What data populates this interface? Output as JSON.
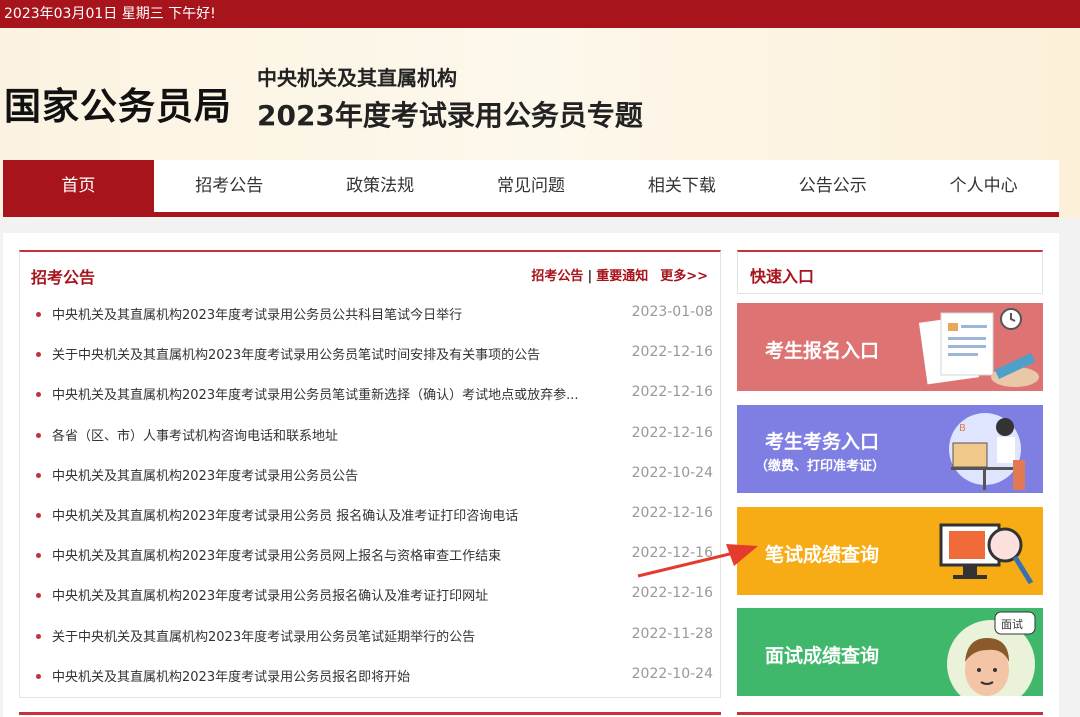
{
  "topbar": {
    "date_text": "2023年03月01日  星期三  下午好!"
  },
  "header": {
    "brand": "国家公务员局",
    "subtitle1": "中央机关及其直属机构",
    "subtitle2": "2023年度考试录用公务员专题"
  },
  "nav": {
    "items": [
      {
        "label": "首页"
      },
      {
        "label": "招考公告"
      },
      {
        "label": "政策法规"
      },
      {
        "label": "常见问题"
      },
      {
        "label": "相关下载"
      },
      {
        "label": "公告公示"
      },
      {
        "label": "个人中心"
      }
    ]
  },
  "panel": {
    "title": "招考公告",
    "link1": "招考公告",
    "separator": "|",
    "link2": "重要通知",
    "more": "更多>>",
    "items": [
      {
        "title": "中央机关及其直属机构2023年度考试录用公务员公共科目笔试今日举行",
        "date": "2023-01-08"
      },
      {
        "title": "关于中央机关及其直属机构2023年度考试录用公务员笔试时间安排及有关事项的公告",
        "date": "2022-12-16"
      },
      {
        "title": "中央机关及其直属机构2023年度考试录用公务员笔试重新选择（确认）考试地点或放弃参...",
        "date": "2022-12-16"
      },
      {
        "title": "各省（区、市）人事考试机构咨询电话和联系地址",
        "date": "2022-12-16"
      },
      {
        "title": "中央机关及其直属机构2023年度考试录用公务员公告",
        "date": "2022-10-24"
      },
      {
        "title": "中央机关及其直属机构2023年度考试录用公务员 报名确认及准考证打印咨询电话",
        "date": "2022-12-16"
      },
      {
        "title": "中央机关及其直属机构2023年度考试录用公务员网上报名与资格审查工作结束",
        "date": "2022-12-16"
      },
      {
        "title": "中央机关及其直属机构2023年度考试录用公务员报名确认及准考证打印网址",
        "date": "2022-12-16"
      },
      {
        "title": "关于中央机关及其直属机构2023年度考试录用公务员笔试延期举行的公告",
        "date": "2022-11-28"
      },
      {
        "title": "中央机关及其直属机构2023年度考试录用公务员报名即将开始",
        "date": "2022-10-24"
      }
    ]
  },
  "quick": {
    "title": "快速入口",
    "cards": [
      {
        "label": "考生报名入口",
        "color": "#de7373"
      },
      {
        "label": "考生考务入口",
        "sublabel": "（缴费、打印准考证）",
        "color": "#7f7ee3"
      },
      {
        "label": "笔试成绩查询",
        "color": "#f7ac16"
      },
      {
        "label": "面试成绩查询",
        "color": "#3fb86b",
        "badge": "面试"
      }
    ]
  },
  "colors": {
    "brand_red": "#a8141c",
    "accent_red": "#c4323a"
  }
}
